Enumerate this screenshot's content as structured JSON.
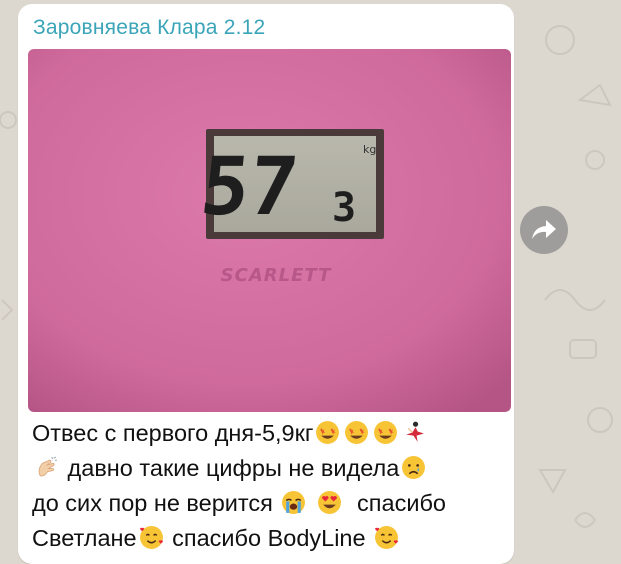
{
  "chat": {
    "sender_name": "Заровняева Клара 2.12",
    "sender_color": "#3aa5b8"
  },
  "photo": {
    "description_icon": "bathroom-scale-photo",
    "scale_brand": "SCARLETT",
    "display_main": "57",
    "display_decimal": "3",
    "display_unit": "kg",
    "scale_color": "#d56ea2"
  },
  "message": {
    "line1_text": "Отвес с первого дня-5,9кг",
    "line2_text": "давно такие цифры не видела",
    "line3_text": "до сих пор не верится",
    "line3_suffix": "спасибо",
    "line4_text": "Светлане",
    "line4_suffix": "спасибо BodyLine"
  },
  "actions": {
    "share_icon": "share-arrow-icon"
  }
}
